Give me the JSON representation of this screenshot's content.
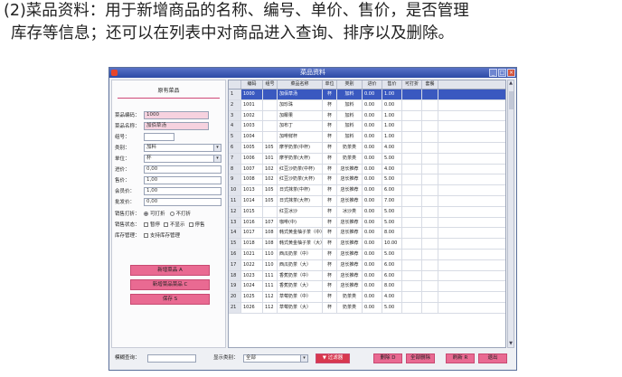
{
  "caption": {
    "line1": "(2)菜品资料：用于新增商品的名称、编号、单价、售价，是否管理",
    "line2": "库存等信息；还可以在列表中对商品进入查询、排序以及删除。"
  },
  "window": {
    "title": "菜品资料",
    "buttons": [
      "_",
      "□",
      "×"
    ]
  },
  "form": {
    "title": "原有菜品",
    "fields": [
      {
        "label": "菜品编码：",
        "value": "1000"
      },
      {
        "label": "菜品名称：",
        "value": "加佰草汤"
      },
      {
        "label": "组号：",
        "value": ""
      },
      {
        "label": "类别：",
        "value": "加料"
      },
      {
        "label": "单位：",
        "value": "杯"
      },
      {
        "label": "进价：",
        "value": "0,00"
      },
      {
        "label": "售价：",
        "value": "1,00"
      },
      {
        "label": "会员价：",
        "value": "1,00"
      },
      {
        "label": "批发价：",
        "value": "0,00"
      }
    ],
    "discount": {
      "label": "销售打折：",
      "opt1": "可打折",
      "opt2": "不打折"
    },
    "status": {
      "label": "销售状态：",
      "opt1": "暂停",
      "opt2": "不显示",
      "opt3": "停售"
    },
    "stock": {
      "label": "库存管理：",
      "opt1": "支持库存管理"
    },
    "buttons": [
      "新增菜品 A",
      "新增菜品菜品 C",
      "保存 S"
    ]
  },
  "table": {
    "headers": [
      "编码",
      "组号",
      "菜品名称",
      "单位",
      "类别",
      "进价",
      "售价",
      "可打折",
      "套餐"
    ],
    "rows": [
      [
        "1000",
        "",
        "加佰草汤",
        "杯",
        "加料",
        "0.00",
        "1.00"
      ],
      [
        "1001",
        "",
        "加珍珠",
        "杯",
        "加料",
        "0.00",
        "0.00"
      ],
      [
        "1002",
        "",
        "加椰果",
        "杯",
        "加料",
        "0.00",
        "1.00"
      ],
      [
        "1003",
        "",
        "加布丁",
        "杯",
        "加料",
        "0.00",
        "1.00"
      ],
      [
        "1004",
        "",
        "加啡鲜杯",
        "杯",
        "加料",
        "0.00",
        "1.00"
      ],
      [
        "1005",
        "105",
        "摩芋奶茶(中杯)",
        "杯",
        "奶茶类",
        "0.00",
        "4.00"
      ],
      [
        "1006",
        "101",
        "摩芋奶茶(大杯)",
        "杯",
        "奶茶类",
        "0.00",
        "5.00"
      ],
      [
        "1007",
        "102",
        "红豆沙奶茶(中杯)",
        "杯",
        "店长推荐",
        "0.00",
        "4.00"
      ],
      [
        "1008",
        "102",
        "红豆沙奶茶(大杯)",
        "杯",
        "店长推荐",
        "0.00",
        "5.00"
      ],
      [
        "1013",
        "105",
        "日式抹茶(中杯)",
        "杯",
        "店长推荐",
        "0.00",
        "6.00"
      ],
      [
        "1014",
        "105",
        "日式抹茶(大杯)",
        "杯",
        "店长推荐",
        "0.00",
        "7.00"
      ],
      [
        "1015",
        "",
        "红豆冰沙",
        "杯",
        "冰沙类",
        "0.00",
        "5.00"
      ],
      [
        "1016",
        "107",
        "咖啡(中)",
        "杯",
        "店长推荐",
        "0.00",
        "5.00"
      ],
      [
        "1017",
        "108",
        "韩式黄金柚子茶（中）",
        "杯",
        "店长推荐",
        "0.00",
        "8.00"
      ],
      [
        "1018",
        "108",
        "韩式黄金柚子茶（大）",
        "杯",
        "店长推荐",
        "0.00",
        "10.00"
      ],
      [
        "1021",
        "110",
        "西瓜奶茶（中）",
        "杯",
        "店长推荐",
        "0.00",
        "5.00"
      ],
      [
        "1022",
        "110",
        "西瓜奶茶（大）",
        "杯",
        "店长推荐",
        "0.00",
        "6.00"
      ],
      [
        "1023",
        "111",
        "香蕉奶茶（中）",
        "杯",
        "店长推荐",
        "0.00",
        "6.00"
      ],
      [
        "1024",
        "111",
        "香蕉奶茶（大）",
        "杯",
        "店长推荐",
        "0.00",
        "8.00"
      ],
      [
        "1025",
        "112",
        "草莓奶茶（中）",
        "杯",
        "奶茶类",
        "0.00",
        "4.00"
      ],
      [
        "1026",
        "112",
        "草莓奶茶（大）",
        "杯",
        "奶茶类",
        "0.00",
        "5.00"
      ]
    ]
  },
  "bottom": {
    "search_label": "模糊查询：",
    "search_value": "",
    "category_label": "显示类别：",
    "category_value": "全部",
    "filter_button": "▼ 过滤器",
    "delete_button": "删除 D",
    "delete_all_button": "全部删除",
    "refresh_button": "刷新 R",
    "exit_button": "退出"
  },
  "colors": {
    "accent": "#e96a92",
    "selection": "#3a59c0",
    "titlebar": "#2c4aa6"
  }
}
